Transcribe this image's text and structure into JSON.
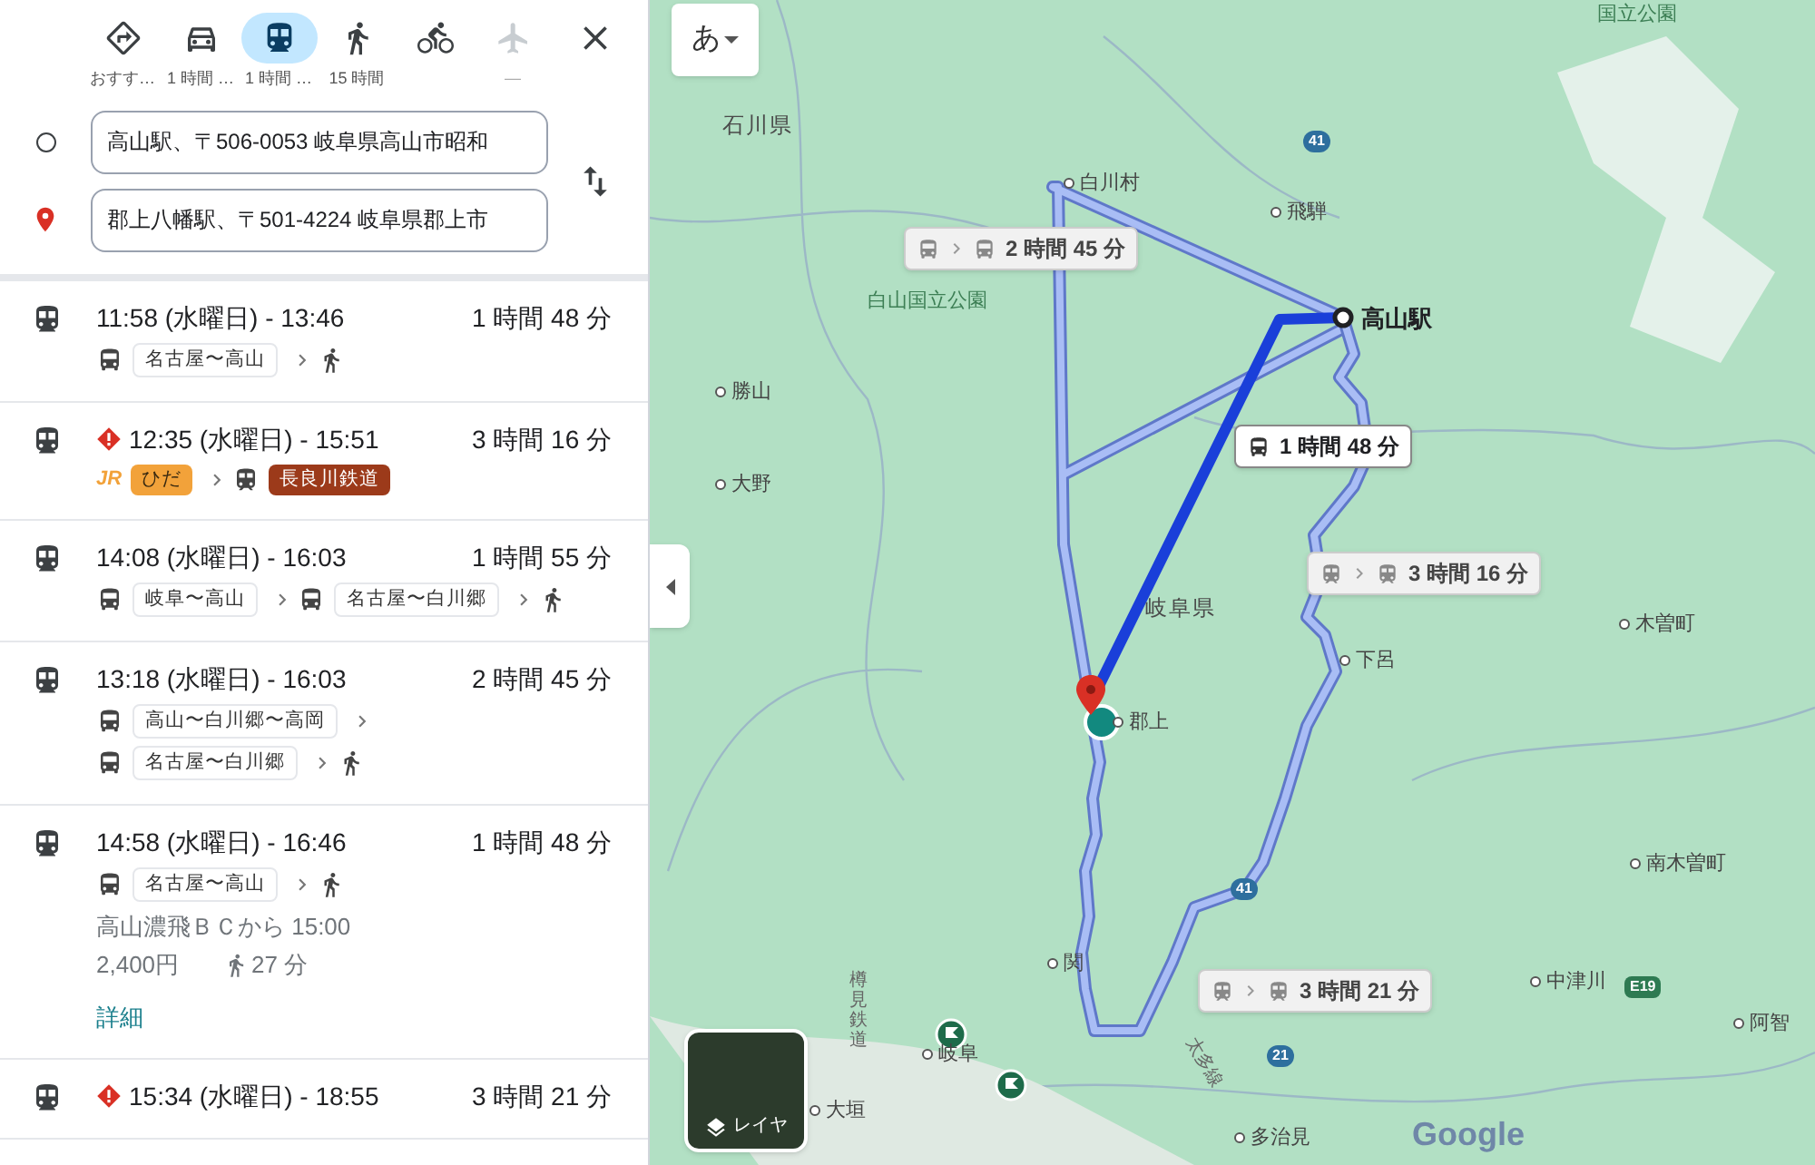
{
  "modes": [
    {
      "kind": "recommended",
      "label": "おすす…",
      "selected": false,
      "disabled": false
    },
    {
      "kind": "car",
      "label": "1 時間 …",
      "selected": false,
      "disabled": false
    },
    {
      "kind": "transit",
      "label": "1 時間 …",
      "selected": true,
      "disabled": false
    },
    {
      "kind": "walk",
      "label": "15 時間",
      "selected": false,
      "disabled": false
    },
    {
      "kind": "bike",
      "selected": false,
      "disabled": false
    },
    {
      "kind": "flight",
      "label": "—",
      "selected": false,
      "disabled": true
    }
  ],
  "origin": {
    "value": "高山駅、〒506-0053 岐阜県高山市昭和"
  },
  "destination": {
    "value": "郡上八幡駅、〒501-4224 岐阜県郡上市"
  },
  "routes": [
    {
      "time": "11:58 (水曜日) - 13:46",
      "duration": "1 時間 48 分",
      "alert": false,
      "steps": [
        {
          "kind": "bus",
          "label": "名古屋〜高山"
        },
        {
          "kind": "walk"
        }
      ]
    },
    {
      "time": "12:35 (水曜日) - 15:51",
      "duration": "3 時間 16 分",
      "alert": true,
      "steps": [
        {
          "kind": "jr",
          "operator": "JR",
          "label": "ひだ",
          "color": "#f2a23a"
        },
        {
          "kind": "rail",
          "label": "長良川鉄道",
          "color": "#9c3a1a"
        }
      ]
    },
    {
      "time": "14:08 (水曜日) - 16:03",
      "duration": "1 時間 55 分",
      "alert": false,
      "steps": [
        {
          "kind": "bus",
          "label": "岐阜〜高山"
        },
        {
          "kind": "bus",
          "label": "名古屋〜白川郷"
        },
        {
          "kind": "walk"
        }
      ]
    },
    {
      "time": "13:18 (水曜日) - 16:03",
      "duration": "2 時間 45 分",
      "alert": false,
      "steps": [
        {
          "kind": "bus",
          "label": "高山〜白川郷〜高岡"
        },
        {
          "kind": "bus",
          "label": "名古屋〜白川郷"
        },
        {
          "kind": "walk"
        }
      ]
    },
    {
      "time": "14:58 (水曜日) - 16:46",
      "duration": "1 時間 48 分",
      "alert": false,
      "steps": [
        {
          "kind": "bus",
          "label": "名古屋〜高山"
        },
        {
          "kind": "walk"
        }
      ],
      "departure": "高山濃飛ＢＣから 15:00",
      "fare": "2,400円",
      "walk_time": "27 分",
      "details_link": "詳細"
    },
    {
      "time": "15:34 (水曜日) - 18:55",
      "duration": "3 時間 21 分",
      "alert": true
    }
  ],
  "map": {
    "language_button": "あ",
    "layer_button": "レイヤ",
    "logo": "Google",
    "labels": [
      {
        "text": "国立公園",
        "kind": "park"
      },
      {
        "text": "石川県",
        "kind": "region"
      },
      {
        "text": "白川村",
        "kind": "town"
      },
      {
        "text": "41",
        "kind": "road"
      },
      {
        "text": "飛騨",
        "kind": "town"
      },
      {
        "text": "白山国立公園",
        "kind": "park"
      },
      {
        "text": "高山駅",
        "kind": "station"
      },
      {
        "text": "勝山",
        "kind": "town"
      },
      {
        "text": "大野",
        "kind": "town"
      },
      {
        "text": "岐阜県",
        "kind": "region"
      },
      {
        "text": "下呂",
        "kind": "town"
      },
      {
        "text": "木曽町",
        "kind": "town"
      },
      {
        "text": "郡上",
        "kind": "town"
      },
      {
        "text": "南木曽町",
        "kind": "town"
      },
      {
        "text": "41",
        "kind": "road"
      },
      {
        "text": "関",
        "kind": "town"
      },
      {
        "text": "中津川",
        "kind": "town"
      },
      {
        "text": "E19",
        "kind": "expressway"
      },
      {
        "text": "岐阜",
        "kind": "town"
      },
      {
        "text": "樽見鉄道",
        "kind": "railway"
      },
      {
        "text": "大垣",
        "kind": "town"
      },
      {
        "text": "21",
        "kind": "road"
      },
      {
        "text": "太多線",
        "kind": "railway"
      },
      {
        "text": "多治見",
        "kind": "town"
      },
      {
        "text": "阿智",
        "kind": "town"
      }
    ],
    "callouts": [
      {
        "kind": "bus-transfer",
        "text": "2 時間 45 分",
        "selected": false
      },
      {
        "kind": "bus",
        "text": "1 時間 48 分",
        "selected": true
      },
      {
        "kind": "train-transfer",
        "text": "3 時間 16 分",
        "selected": false
      },
      {
        "kind": "train-transfer",
        "text": "3 時間 21 分",
        "selected": false
      }
    ]
  }
}
